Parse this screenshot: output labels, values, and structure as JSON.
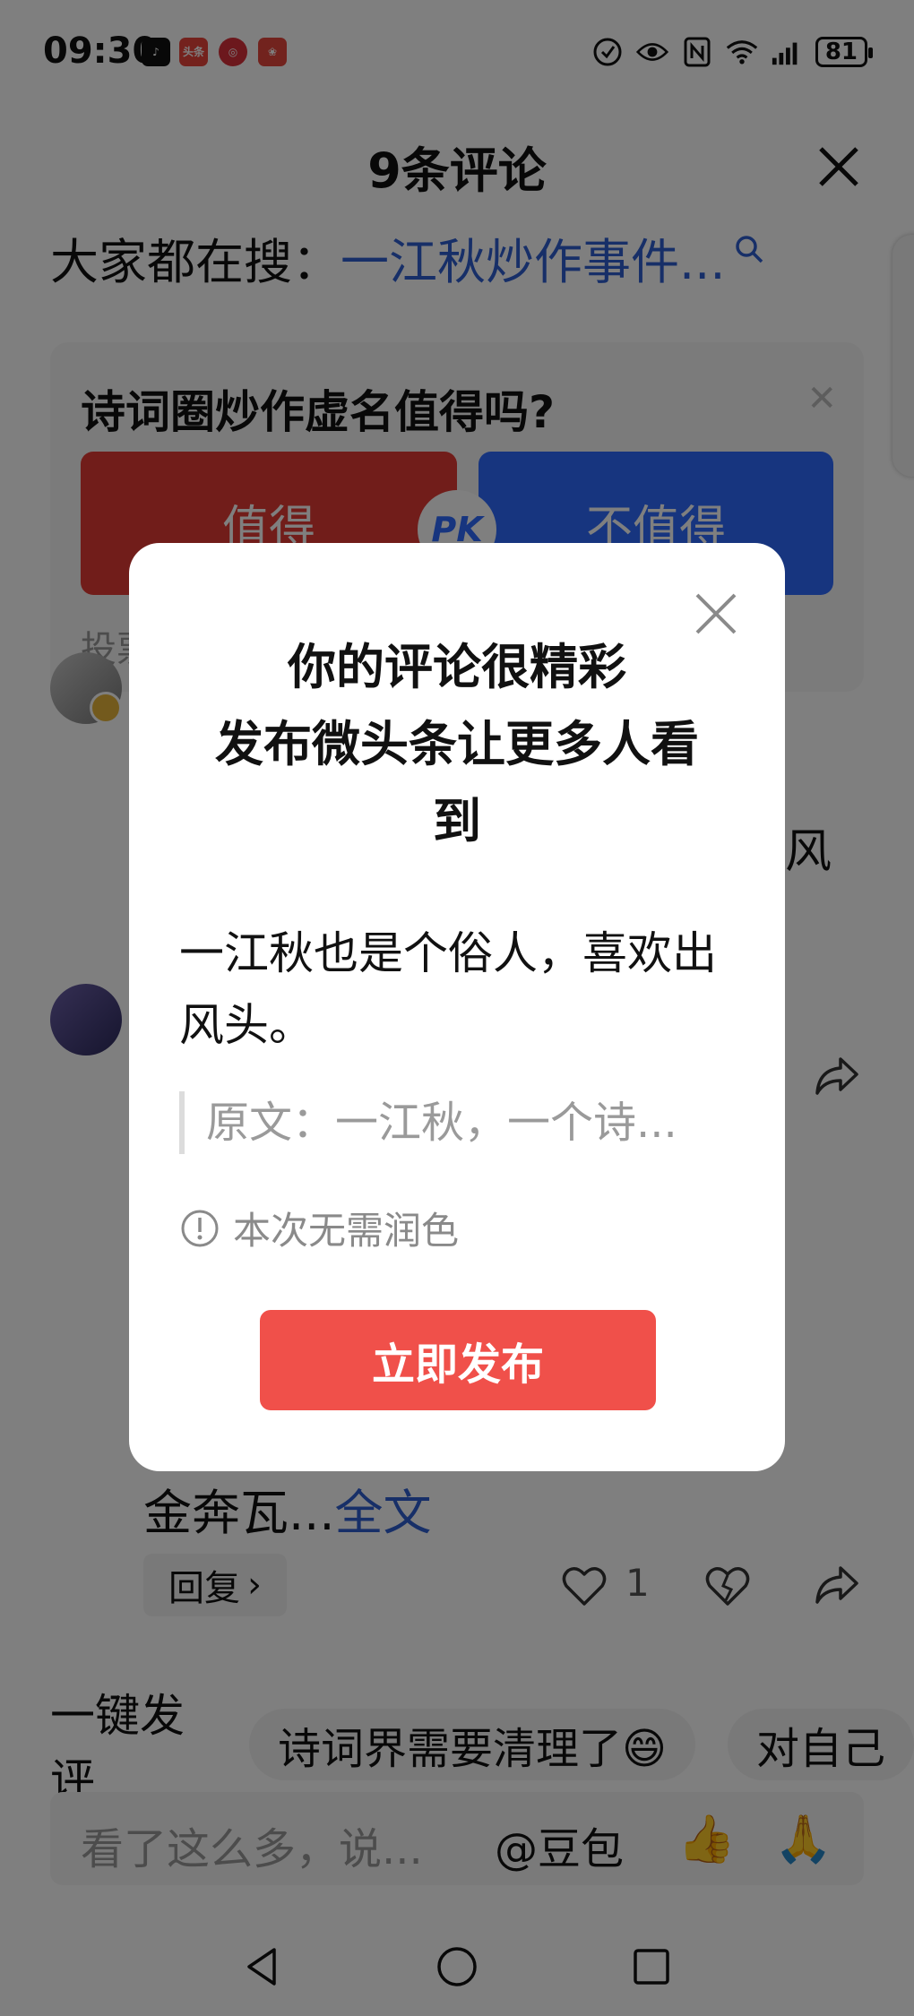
{
  "status_bar": {
    "time": "09:30",
    "app_icons": [
      "tiktok-icon",
      "toutiao-icon",
      "app-icon",
      "huawei-icon"
    ],
    "app_icon_labels": [
      "头条"
    ],
    "battery": "81"
  },
  "sheet": {
    "title": "9条评论",
    "search_label": "大家都在搜：",
    "search_query": "一江秋炒作事件..."
  },
  "poll": {
    "question": "诗词圈炒作虚名值得吗?",
    "option_yes": "值得",
    "option_no": "不值得",
    "pk_label": "PK",
    "footer_fragment": "投票"
  },
  "background_comments": {
    "fragment_1": "风",
    "comment_text": "金奔瓦...",
    "more_link": "全文",
    "reply_label": "回复",
    "like_count": "1"
  },
  "suggestions": {
    "label": "一键发评",
    "chips": [
      "诗词界需要清理了😄",
      "对自己"
    ]
  },
  "input": {
    "placeholder": "看了这么多，说...",
    "mention": "@豆包",
    "emojis": [
      "👍",
      "🙏"
    ]
  },
  "dialog": {
    "title": "你的评论很精彩\n发布微头条让更多人看到",
    "title_line1": "你的评论很精彩",
    "title_line2": "发布微头条让更多人看",
    "title_line3": "到",
    "body": "一江秋也是个俗人，喜欢出风头。",
    "quote": "原文：一江秋，一个诗...",
    "note": "本次无需润色",
    "publish_label": "立即发布"
  },
  "colors": {
    "accent_red": "#f0504a",
    "link_blue": "#2f5fd0",
    "poll_red": "#e33b34",
    "poll_blue": "#2f6bff"
  }
}
